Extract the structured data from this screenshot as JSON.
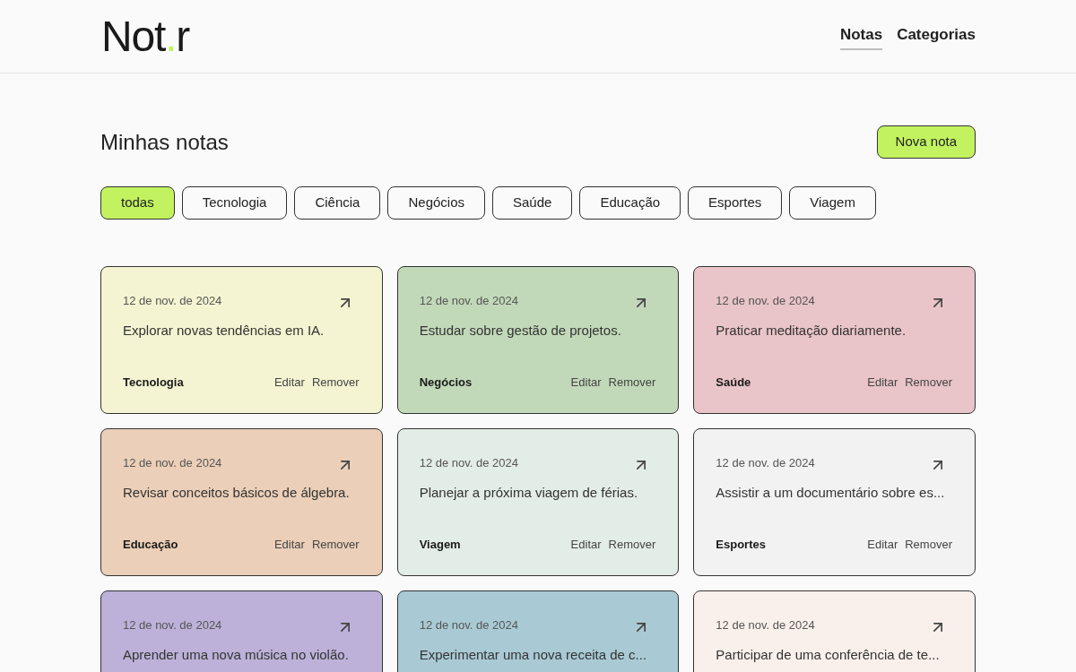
{
  "header": {
    "logo": {
      "start": "Not",
      "accent": ".",
      "end": "r"
    },
    "nav": [
      {
        "label": "Notas",
        "selected": true
      },
      {
        "label": "Categorias",
        "selected": false
      }
    ]
  },
  "page_title": "Minhas notas",
  "new_button": "Nova nota",
  "filters": [
    {
      "label": "todas",
      "selected": true
    },
    {
      "label": "Tecnologia",
      "selected": false
    },
    {
      "label": "Ciência",
      "selected": false
    },
    {
      "label": "Negócios",
      "selected": false
    },
    {
      "label": "Saúde",
      "selected": false
    },
    {
      "label": "Educação",
      "selected": false
    },
    {
      "label": "Esportes",
      "selected": false
    },
    {
      "label": "Viagem",
      "selected": false
    }
  ],
  "notes": [
    {
      "date": "12 de nov. de 2024",
      "text": "Explorar novas tendências em IA.",
      "category": "Tecnologia",
      "color": "#f4f4d2",
      "actions": [
        "Editar",
        "Remover"
      ]
    },
    {
      "date": "12 de nov. de 2024",
      "text": "Estudar sobre gestão de projetos.",
      "category": "Negócios",
      "color": "#c2d9b9",
      "actions": [
        "Editar",
        "Remover"
      ]
    },
    {
      "date": "12 de nov. de 2024",
      "text": "Praticar meditação diariamente.",
      "category": "Saúde",
      "color": "#e9c4c8",
      "actions": [
        "Editar",
        "Remover"
      ]
    },
    {
      "date": "12 de nov. de 2024",
      "text": "Revisar conceitos básicos de álgebra.",
      "category": "Educação",
      "color": "#ebcfb8",
      "actions": [
        "Editar",
        "Remover"
      ]
    },
    {
      "date": "12 de nov. de 2024",
      "text": "Planejar a próxima viagem de férias.",
      "category": "Viagem",
      "color": "#e3ede8",
      "actions": [
        "Editar",
        "Remover"
      ]
    },
    {
      "date": "12 de nov. de 2024",
      "text": "Assistir a um documentário sobre es...",
      "category": "Esportes",
      "color": "#f2f2f2",
      "actions": [
        "Editar",
        "Remover"
      ]
    },
    {
      "date": "12 de nov. de 2024",
      "text": "Aprender uma nova música no violão.",
      "color": "#bdb1d9"
    },
    {
      "date": "12 de nov. de 2024",
      "text": "Experimentar uma nova receita de c...",
      "color": "#a9cad4"
    },
    {
      "date": "12 de nov. de 2024",
      "text": "Participar de uma conferência de te...",
      "color": "#faf0eb"
    }
  ]
}
